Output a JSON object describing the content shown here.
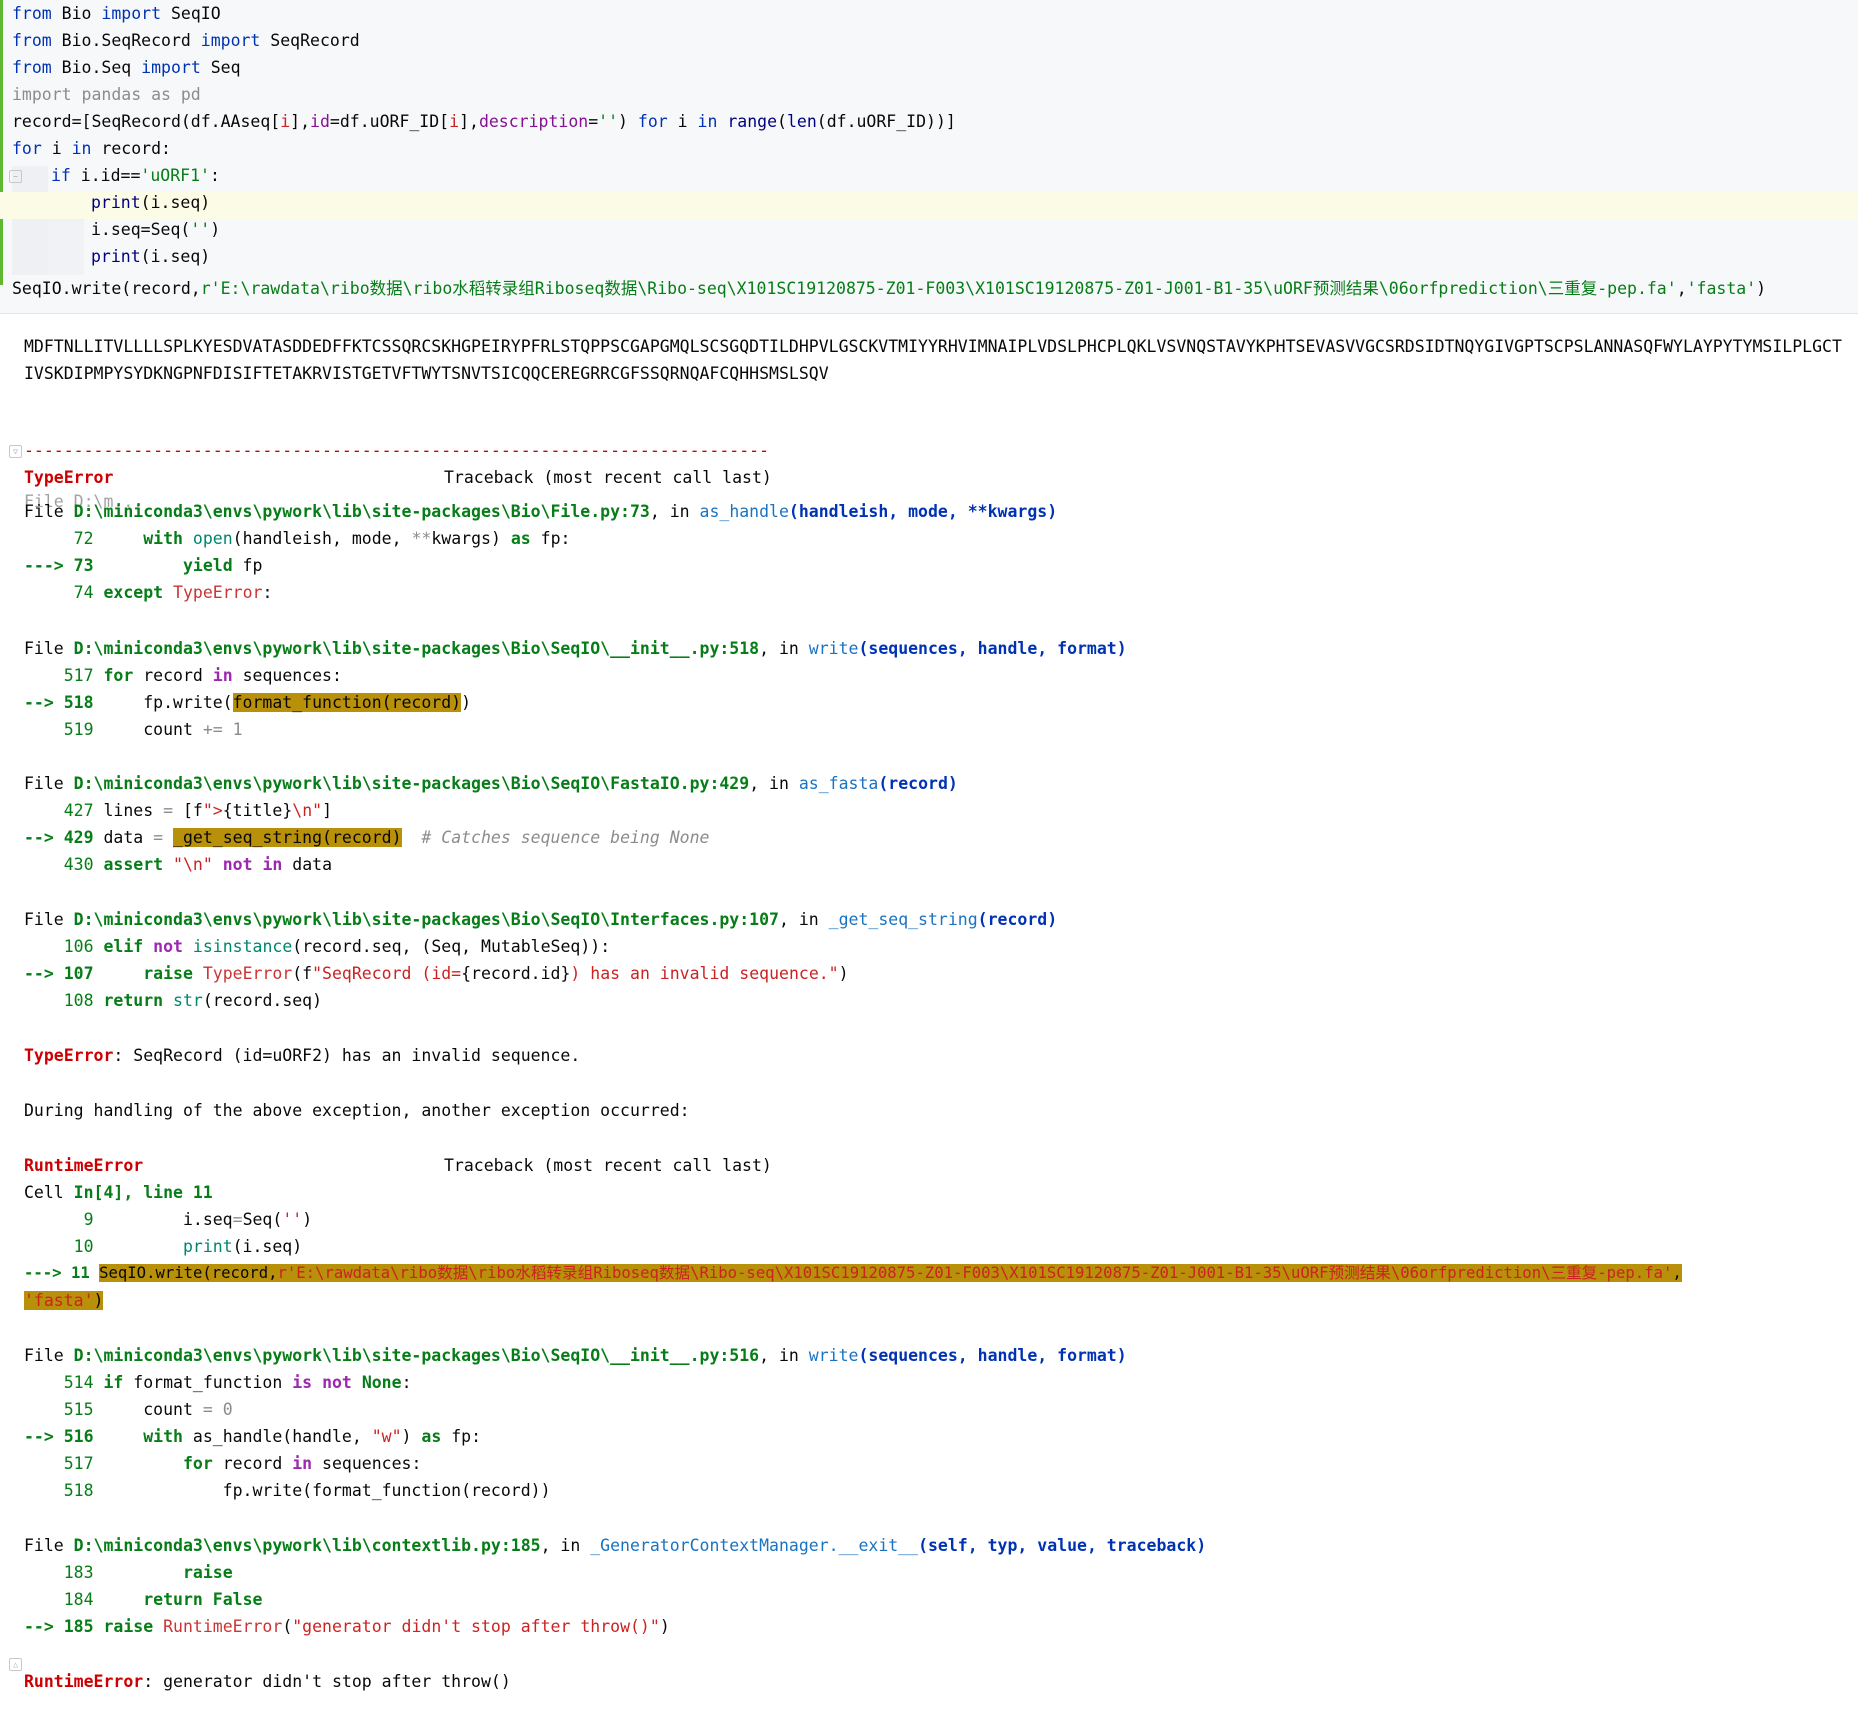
{
  "code_cell": {
    "l1_from": "from",
    "l1_mod": " Bio ",
    "l1_import": "import",
    "l1_name": " SeqIO",
    "l2_from": "from",
    "l2_mod": " Bio.SeqRecord ",
    "l2_import": "import",
    "l2_name": " SeqRecord",
    "l3_from": "from",
    "l3_mod": " Bio.Seq ",
    "l3_import": "import",
    "l3_name": " Seq",
    "l4": "import pandas as pd",
    "l5_a": "record=[SeqRecord(df.AAseq[",
    "l5_i1": "i",
    "l5_b": "],",
    "l5_id": "id",
    "l5_c": "=df.uORF_ID[",
    "l5_i2": "i",
    "l5_d": "],",
    "l5_desc": "description",
    "l5_e": "=",
    "l5_str": "''",
    "l5_f": ") ",
    "l5_for": "for",
    "l5_g": " i ",
    "l5_in": "in",
    "l5_h": " ",
    "l5_range": "range",
    "l5_i": "(",
    "l5_len": "len",
    "l5_j": "(df.uORF_ID))]",
    "l6_for": "for",
    "l6_a": " i ",
    "l6_in": "in",
    "l6_b": " record:",
    "l7_if": "if",
    "l7_a": " i.id==",
    "l7_str": "'uORF1'",
    "l7_b": ":",
    "l8_print": "print",
    "l8_a": "(i.seq)",
    "l9_a": "i.seq=Seq(",
    "l9_str": "''",
    "l9_b": ")",
    "l10_print": "print",
    "l10_a": "(i.seq)",
    "l11_a": "SeqIO.write(record,",
    "l11_path": "r'E:\\rawdata\\ribo数据\\ribo水稻转录组Riboseq数据\\Ribo-seq\\X101SC19120875-Z01-F003\\X101SC19120875-Z01-J001-B1-35\\uORF预测结果\\06orfprediction\\三重复-pep.fa'",
    "l11_b": ",",
    "l11_fmt": "'fasta'",
    "l11_c": ")"
  },
  "output": {
    "seq_line1": "MDFTNLLITVLLLLSPLKYESDVATASDDEDFFKTCSSQRCSKHGPEIRYPFRLSTQPPSCGAPGMQLSCSGQDTILDHPVLGSCKVTMIYYRHVIMNAIPLVDSLPHCPLQKLVSVNQSTAVYKPHTSEVASVVGCSRDSIDTNQYGIVGPTSCPSLANNASQFWYLAYPYTYMSILPLGCT",
    "seq_line2": "IVSKDIPMPYSYDKNGPNFDISIFTETAKRVISTGETVFTWYTSNVTSICQQCEREGRRCGFSSQRNQAFCQHHSMSLSQV",
    "dashes": "---------------------------------------------------------------------------",
    "tb1_name": "TypeError",
    "tb1_title": "Traceback (most recent call last)",
    "overlap_ghost": "File D:\\m...",
    "f1_file": "File ",
    "f1_path": "D:\\miniconda3\\envs\\pywork\\lib\\site-packages\\Bio\\File.py:73",
    "f1_in": ", in ",
    "f1_fn": "as_handle",
    "f1_args": "(handleish, mode, **kwargs)",
    "f1_72_n": "     72",
    "f1_72_a": "     ",
    "f1_72_with": "with",
    "f1_72_b": " ",
    "f1_72_open": "open",
    "f1_72_c": "(handleish, mode, ",
    "f1_72_star": "**",
    "f1_72_d": "kwargs) ",
    "f1_72_as": "as",
    "f1_72_e": " fp:",
    "f1_73_arrow": "---> 73",
    "f1_73_a": "         ",
    "f1_73_yield": "yield",
    "f1_73_b": " fp",
    "f1_74_n": "     74",
    "f1_74_a": " ",
    "f1_74_except": "except",
    "f1_74_b": " ",
    "f1_74_exc": "TypeError",
    "f1_74_c": ":",
    "f2_file": "File ",
    "f2_path": "D:\\miniconda3\\envs\\pywork\\lib\\site-packages\\Bio\\SeqIO\\__init__.py:518",
    "f2_in": ", in ",
    "f2_fn": "write",
    "f2_args": "(sequences, handle, format)",
    "f2_517_n": "    517",
    "f2_517_a": " ",
    "f2_517_for": "for",
    "f2_517_b": " record ",
    "f2_517_in": "in",
    "f2_517_c": " sequences:",
    "f2_518_arrow": "--> 518",
    "f2_518_a": "     fp.write(",
    "f2_518_hl": "format_function(record)",
    "f2_518_b": ")",
    "f2_519_n": "    519",
    "f2_519_a": "     count ",
    "f2_519_op": "+=",
    "f2_519_b": " ",
    "f2_519_num": "1",
    "f3_file": "File ",
    "f3_path": "D:\\miniconda3\\envs\\pywork\\lib\\site-packages\\Bio\\SeqIO\\FastaIO.py:429",
    "f3_in": ", in ",
    "f3_fn": "as_fasta",
    "f3_args": "(record)",
    "f3_427_n": "    427",
    "f3_427_a": " lines ",
    "f3_427_op": "=",
    "f3_427_b": " [f",
    "f3_427_s1": "\">",
    "f3_427_c": "{title}",
    "f3_427_s2": "\\n\"",
    "f3_427_d": "]",
    "f3_429_arrow": "--> 429",
    "f3_429_a": " data ",
    "f3_429_op": "=",
    "f3_429_b": " ",
    "f3_429_hl": "_get_seq_string(record)",
    "f3_429_c": "  ",
    "f3_429_cmt": "# Catches sequence being None",
    "f3_430_n": "    430",
    "f3_430_a": " ",
    "f3_430_assert": "assert",
    "f3_430_b": " ",
    "f3_430_s": "\"\\n\"",
    "f3_430_c": " ",
    "f3_430_not": "not",
    "f3_430_d": " ",
    "f3_430_in": "in",
    "f3_430_e": " data",
    "f4_file": "File ",
    "f4_path": "D:\\miniconda3\\envs\\pywork\\lib\\site-packages\\Bio\\SeqIO\\Interfaces.py:107",
    "f4_in": ", in ",
    "f4_fn": "_get_seq_string",
    "f4_args": "(record)",
    "f4_106_n": "    106",
    "f4_106_a": " ",
    "f4_106_elif": "elif",
    "f4_106_b": " ",
    "f4_106_not": "not",
    "f4_106_c": " ",
    "f4_106_isinst": "isinstance",
    "f4_106_d": "(record.seq, (Seq, MutableSeq)):",
    "f4_107_arrow": "--> 107",
    "f4_107_a": "     ",
    "f4_107_raise": "raise",
    "f4_107_b": " ",
    "f4_107_exc": "TypeError",
    "f4_107_c": "(f",
    "f4_107_s1": "\"SeqRecord (id=",
    "f4_107_d": "{record.id}",
    "f4_107_s2": ") has an invalid sequence.\"",
    "f4_107_e": ")",
    "f4_108_n": "    108",
    "f4_108_a": " ",
    "f4_108_return": "return",
    "f4_108_b": " ",
    "f4_108_str": "str",
    "f4_108_c": "(record.seq)",
    "err1_name": "TypeError",
    "err1_msg": ": SeqRecord (id=uORF2) has an invalid sequence.",
    "during": "During handling of the above exception, another exception occurred:",
    "tb2_name": "RuntimeError",
    "tb2_title": "Traceback (most recent call last)",
    "cell_a": "Cell ",
    "cell_in": "In[4], line 11",
    "c9_n": "      9",
    "c9_a": "         i.seq",
    "c9_op": "=",
    "c9_b": "Seq(",
    "c9_s": "''",
    "c9_c": ")",
    "c10_n": "     10",
    "c10_a": "         ",
    "c10_print": "print",
    "c10_b": "(i.seq)",
    "c11_arrow": "---> 11",
    "c11_a": " ",
    "c11_hl1": "SeqIO",
    "c11_hl2": ".write(record,",
    "c11_hl3": "r'E:\\rawdata\\ribo数据\\ribo水稻转录组Riboseq数据\\Ribo-seq\\X101SC19120875-Z01-F003\\X101SC19120875-Z01-J001-B1-35\\uORF预测结果\\06orfprediction\\三重复-pep.fa'",
    "c11_hl4": ",",
    "c11_l2_s": "'fasta'",
    "c11_l2_b": ")",
    "f5_file": "File ",
    "f5_path": "D:\\miniconda3\\envs\\pywork\\lib\\site-packages\\Bio\\SeqIO\\__init__.py:516",
    "f5_in": ", in ",
    "f5_fn": "write",
    "f5_args": "(sequences, handle, format)",
    "f5_514_n": "    514",
    "f5_514_a": " ",
    "f5_514_if": "if",
    "f5_514_b": " format_function ",
    "f5_514_is": "is",
    "f5_514_c": " ",
    "f5_514_not": "not",
    "f5_514_d": " ",
    "f5_514_none": "None",
    "f5_514_e": ":",
    "f5_515_n": "    515",
    "f5_515_a": "     count ",
    "f5_515_op": "=",
    "f5_515_b": " ",
    "f5_515_num": "0",
    "f5_516_arrow": "--> 516",
    "f5_516_a": "     ",
    "f5_516_with": "with",
    "f5_516_b": " as_handle(handle, ",
    "f5_516_s": "\"w\"",
    "f5_516_c": ") ",
    "f5_516_as": "as",
    "f5_516_d": " fp:",
    "f5_517_n": "    517",
    "f5_517_a": "         ",
    "f5_517_for": "for",
    "f5_517_b": " record ",
    "f5_517_in": "in",
    "f5_517_c": " sequences:",
    "f5_518_n": "    518",
    "f5_518_a": "             fp.write(format_function(record))",
    "f6_file": "File ",
    "f6_path": "D:\\miniconda3\\envs\\pywork\\lib\\contextlib.py:185",
    "f6_in": ", in ",
    "f6_fn": "_GeneratorContextManager.__exit__",
    "f6_args": "(self, typ, value, traceback)",
    "f6_183_n": "    183",
    "f6_183_a": "         ",
    "f6_183_raise": "raise",
    "f6_184_n": "    184",
    "f6_184_a": "     ",
    "f6_184_return": "return",
    "f6_184_b": " ",
    "f6_184_false": "False",
    "f6_185_arrow": "--> 185",
    "f6_185_a": " ",
    "f6_185_raise": "raise",
    "f6_185_b": " ",
    "f6_185_exc": "RuntimeError",
    "f6_185_c": "(",
    "f6_185_s": "\"generator didn't stop after throw()\"",
    "f6_185_d": ")",
    "err2_name": "RuntimeError",
    "err2_msg": ": generator didn't stop after throw()"
  },
  "icons": [
    "fold-marker-icon",
    "output-marker-icon"
  ]
}
